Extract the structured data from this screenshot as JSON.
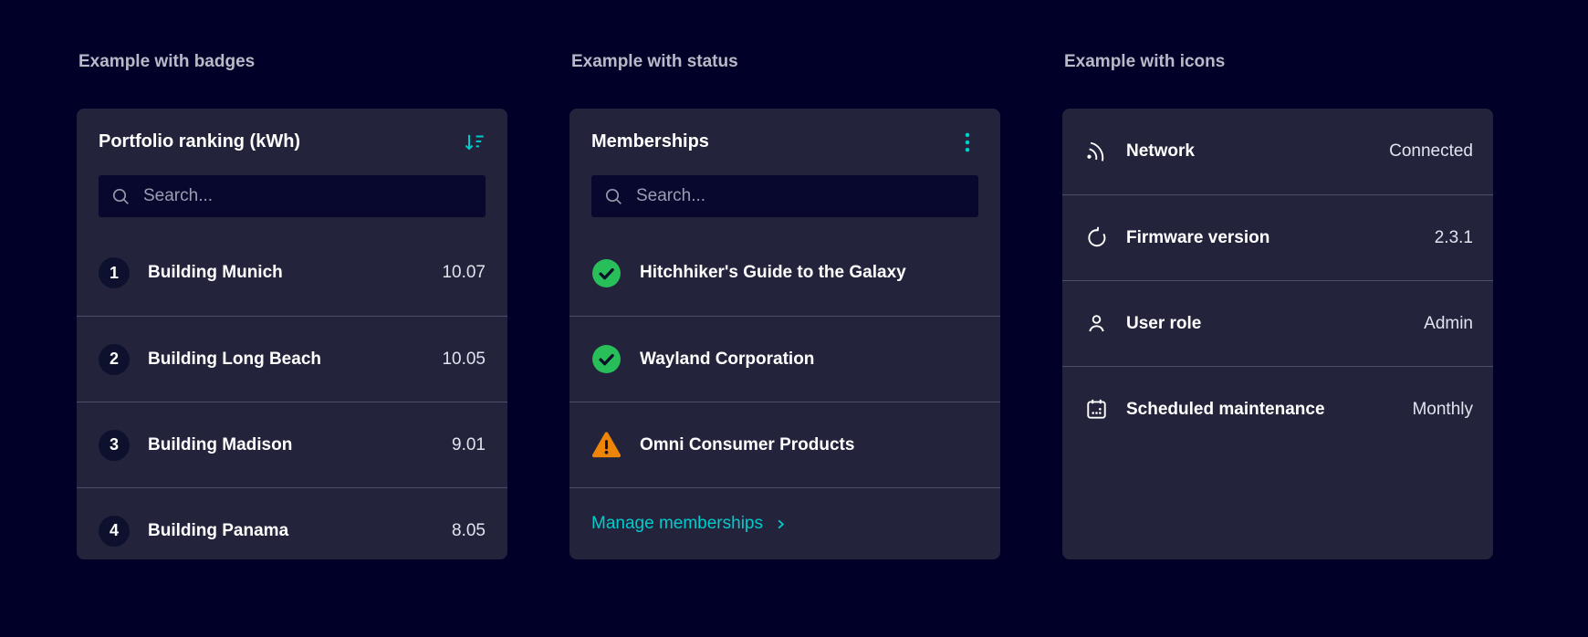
{
  "page": {
    "background_color": "#000028",
    "card_color": "#23233C",
    "accent_color": "#00CCCC",
    "success_color": "#28BE5A",
    "warning_color": "#EE8508"
  },
  "sections": {
    "badges": {
      "heading": "Example with badges",
      "card": {
        "title": "Portfolio ranking (kWh)",
        "header_icon": "sort-descending-icon",
        "search_placeholder": "Search...",
        "search_icon": "search-icon",
        "items": [
          {
            "badge": "1",
            "label": "Building Munich",
            "value": "10.07"
          },
          {
            "badge": "2",
            "label": "Building Long Beach",
            "value": "10.05"
          },
          {
            "badge": "3",
            "label": "Building Madison",
            "value": "9.01"
          },
          {
            "badge": "4",
            "label": "Building Panama",
            "value": "8.05"
          }
        ]
      }
    },
    "status": {
      "heading": "Example with status",
      "card": {
        "title": "Memberships",
        "header_icon": "kebab-menu-icon",
        "search_placeholder": "Search...",
        "search_icon": "search-icon",
        "items": [
          {
            "status": "success",
            "status_icon": "check-circle-icon",
            "label": "Hitchhiker's Guide to the Galaxy"
          },
          {
            "status": "success",
            "status_icon": "check-circle-icon",
            "label": "Wayland Corporation"
          },
          {
            "status": "warning",
            "status_icon": "warning-triangle-icon",
            "label": "Omni Consumer Products"
          }
        ],
        "footer_link": "Manage memberships",
        "footer_link_icon": "chevron-right-icon"
      }
    },
    "icons": {
      "heading": "Example with icons",
      "card": {
        "rows": [
          {
            "icon": "network-icon",
            "label": "Network",
            "value": "Connected"
          },
          {
            "icon": "refresh-icon",
            "label": "Firmware version",
            "value": "2.3.1"
          },
          {
            "icon": "user-icon",
            "label": "User role",
            "value": "Admin"
          },
          {
            "icon": "calendar-icon",
            "label": "Scheduled maintenance",
            "value": "Monthly"
          }
        ]
      }
    }
  }
}
